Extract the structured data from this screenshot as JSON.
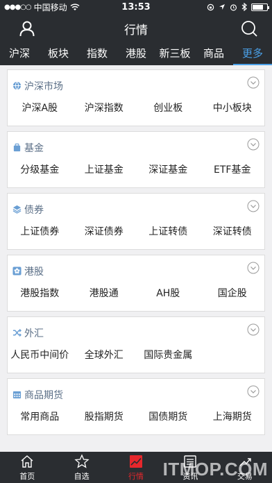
{
  "status_bar": {
    "signal_dots": "●●●○○",
    "carrier": "中国移动",
    "time": "13:53"
  },
  "header": {
    "title": "行情"
  },
  "tabs": [
    {
      "label": "沪深"
    },
    {
      "label": "板块"
    },
    {
      "label": "指数"
    },
    {
      "label": "港股"
    },
    {
      "label": "新三板"
    },
    {
      "label": "商品"
    },
    {
      "label": "更多",
      "active": true
    }
  ],
  "sections": [
    {
      "title": "沪深市场",
      "icon": "globe-icon",
      "items": [
        "沪深A股",
        "沪深指数",
        "创业板",
        "中小板块"
      ]
    },
    {
      "title": "基金",
      "icon": "fund-bag-icon",
      "items": [
        "分级基金",
        "上证基金",
        "深证基金",
        "ETF基金"
      ]
    },
    {
      "title": "债券",
      "icon": "layers-icon",
      "items": [
        "上证债券",
        "深证债券",
        "上证转债",
        "深证转债"
      ]
    },
    {
      "title": "港股",
      "icon": "hk-flower-icon",
      "items": [
        "港股指数",
        "港股通",
        "AH股",
        "国企股"
      ]
    },
    {
      "title": "外汇",
      "icon": "exchange-icon",
      "items": [
        "人民币中间价",
        "全球外汇",
        "国际贵金属",
        ""
      ]
    },
    {
      "title": "商品期货",
      "icon": "calendar-icon",
      "items": [
        "常用商品",
        "股指期货",
        "国债期货",
        "上海期货"
      ]
    }
  ],
  "bottom_nav": [
    {
      "label": "首页",
      "icon": "home-icon"
    },
    {
      "label": "自选",
      "icon": "star-icon"
    },
    {
      "label": "行情",
      "icon": "chart-icon",
      "active": true
    },
    {
      "label": "资讯",
      "icon": "news-icon"
    },
    {
      "label": "交易",
      "icon": "trade-icon"
    }
  ],
  "watermark": "ITMOP.COM",
  "colors": {
    "bar_bg": "#2a2d31",
    "accent_blue": "#4aa0e8",
    "active_red": "#e6272c",
    "section_title": "#5a6e86",
    "icon_blue": "#6a9fd4"
  }
}
